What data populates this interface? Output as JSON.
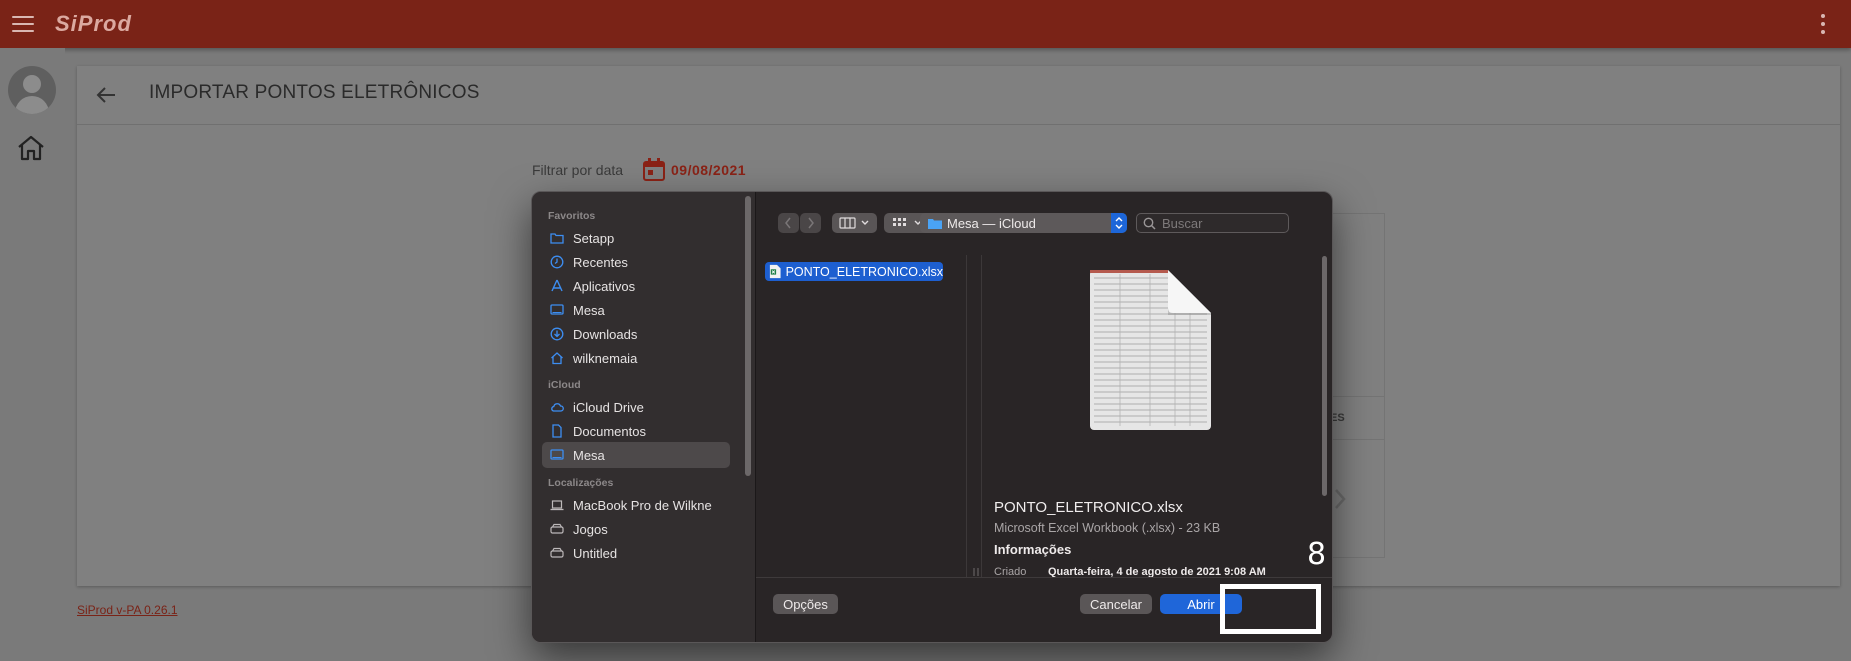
{
  "app": {
    "logo": "SiProd",
    "version": "SiProd v-PA 0.26.1"
  },
  "page": {
    "title": "IMPORTAR PONTOS ELETRÔNICOS",
    "filter_label": "Filtrar por data",
    "filter_date": "09/08/2021",
    "bg_column_fragment": "ES"
  },
  "dialog": {
    "sidebar": {
      "favorites_heading": "Favoritos",
      "favorites": [
        {
          "label": "Setapp",
          "icon": "folder-icon"
        },
        {
          "label": "Recentes",
          "icon": "clock-icon"
        },
        {
          "label": "Aplicativos",
          "icon": "apps-icon"
        },
        {
          "label": "Mesa",
          "icon": "desktop-icon"
        },
        {
          "label": "Downloads",
          "icon": "download-icon"
        },
        {
          "label": "wilknemaia",
          "icon": "home-icon"
        }
      ],
      "icloud_heading": "iCloud",
      "icloud": [
        {
          "label": "iCloud Drive",
          "icon": "cloud-icon"
        },
        {
          "label": "Documentos",
          "icon": "document-icon"
        },
        {
          "label": "Mesa",
          "icon": "desktop-icon",
          "selected": true
        }
      ],
      "locations_heading": "Localizações",
      "locations": [
        {
          "label": "MacBook Pro de Wilkne",
          "icon": "laptop-icon"
        },
        {
          "label": "Jogos",
          "icon": "drive-icon"
        },
        {
          "label": "Untitled",
          "icon": "drive-icon"
        }
      ]
    },
    "toolbar": {
      "location": "Mesa — iCloud",
      "search_placeholder": "Buscar"
    },
    "files": [
      {
        "name": "PONTO_ELETRONICO.xlsx",
        "selected": true
      }
    ],
    "preview": {
      "name": "PONTO_ELETRONICO.xlsx",
      "kind": "Microsoft Excel Workbook (.xlsx) - 23 KB",
      "info_heading": "Informações",
      "created_label": "Criado",
      "created_value": "Quarta-feira, 4 de agosto de 2021 9:08 AM"
    },
    "buttons": {
      "options": "Opções",
      "cancel": "Cancelar",
      "open": "Abrir"
    }
  },
  "annotation": {
    "step_number": "8"
  },
  "colors": {
    "app_bar": "#7a2317",
    "accent_blue": "#1f66d9",
    "date_red": "#8a2216"
  }
}
